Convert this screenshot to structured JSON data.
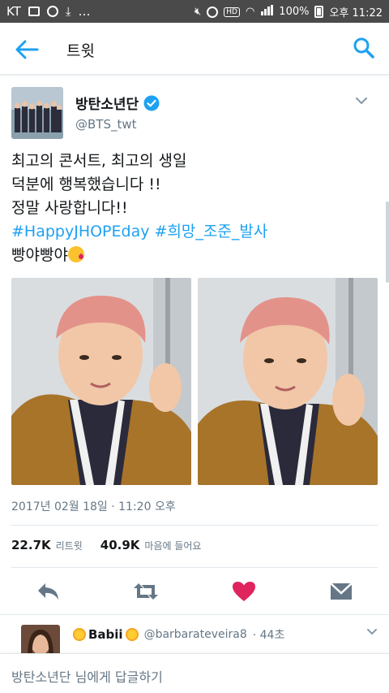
{
  "status_bar": {
    "carrier": "KT",
    "battery": "100%",
    "time": "오후 11:22",
    "icons": [
      "image-icon",
      "record-icon",
      "download-icon",
      "more-icon",
      "mute-icon",
      "alarm-icon",
      "hd-icon",
      "wifi-icon",
      "signal-icon",
      "battery-icon"
    ]
  },
  "app_bar": {
    "title": "트윗",
    "back_icon": "arrow-left-icon",
    "search_icon": "search-icon"
  },
  "tweet": {
    "author_name": "방탄소년단",
    "author_handle": "@BTS_twt",
    "verified": true,
    "text_line1": "최고의 콘서트, 최고의 생일",
    "text_line2": "덕분에 행복했습니다 !!",
    "text_line3": "정말 사랑합니다!!",
    "hashtag1": "#HappyJHOPEday",
    "hashtag2": "#희망_조준_발사",
    "text_line5": "빵야빵야",
    "emoji_icon": "kissing-face-icon",
    "timestamp": "2017년 02월 18일 · 11:20 오후",
    "retweets_count": "22.7K",
    "retweets_label": "리트윗",
    "likes_count": "40.9K",
    "likes_label": "마음에 들어요",
    "liked": true
  },
  "reply_preview": {
    "name": "Babii",
    "handle": "@barbarateveira8",
    "time_ago": "· 44초"
  },
  "compose": {
    "placeholder": "방탄소년단 님에게 답글하기"
  },
  "colors": {
    "accent": "#1da1f2",
    "like": "#e0245e",
    "text": "#14171a",
    "muted": "#657786",
    "statusbar": "#4a4a4a"
  }
}
